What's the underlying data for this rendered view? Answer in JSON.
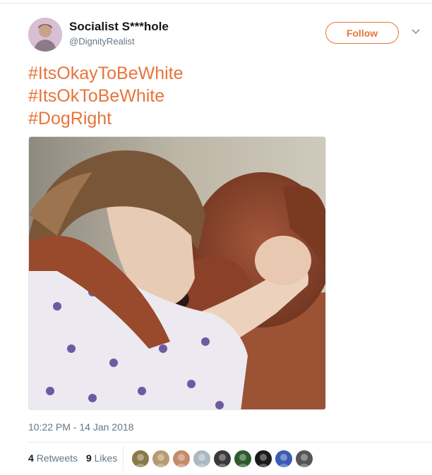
{
  "tweet": {
    "display_name": "Socialist S***hole",
    "handle": "@DignityRealist",
    "follow_label": "Follow",
    "hashtags": [
      "#ItsOkayToBeWhite",
      "#ItsOkToBeWhite",
      "#DogRight"
    ],
    "timestamp": "10:22 PM - 14 Jan 2018",
    "retweets_count": "4",
    "retweets_label": "Retweets",
    "likes_count": "9",
    "likes_label": "Likes"
  },
  "colors": {
    "accent": "#e8743b",
    "text": "#14171a",
    "secondary_text": "#657786",
    "border": "#e6ecf0"
  },
  "icons": {
    "more": "chevron-down-icon"
  },
  "liker_avatars": [
    {
      "name": "liker-avatar-1",
      "color": "#8a7a4a"
    },
    {
      "name": "liker-avatar-2",
      "color": "#b59a72"
    },
    {
      "name": "liker-avatar-3",
      "color": "#c58a6a"
    },
    {
      "name": "liker-avatar-4",
      "color": "#aab8c2"
    },
    {
      "name": "liker-avatar-5",
      "color": "#3a3a3a"
    },
    {
      "name": "liker-avatar-6",
      "color": "#2d5a2d"
    },
    {
      "name": "liker-avatar-7",
      "color": "#1a1a1a"
    },
    {
      "name": "liker-avatar-8",
      "color": "#3b5bb5"
    },
    {
      "name": "liker-avatar-9",
      "color": "#555555"
    }
  ]
}
